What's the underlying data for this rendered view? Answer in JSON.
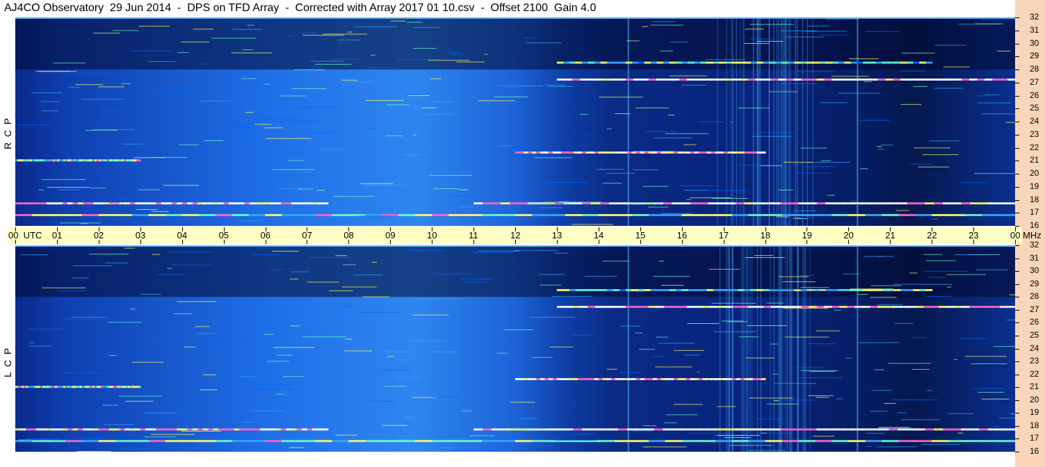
{
  "title": "AJ4CO Observatory  29 Jun 2014  -  DPS on TFD Array  -  Corrected with Array 2017 01 10.csv  -  Offset 2100  Gain 4.0",
  "panels": [
    {
      "id": "rcp",
      "label": "R  C  P"
    },
    {
      "id": "lcp",
      "label": "L  C  P"
    }
  ],
  "chart_data": {
    "type": "heatmap",
    "title": "AJ4CO Observatory  29 Jun 2014  -  DPS on TFD Array  -  Corrected with Array 2017 01 10.csv  -  Offset 2100  Gain 4.0",
    "x_label_start": "00  UTC",
    "x_ticks": [
      "00",
      "01",
      "02",
      "03",
      "04",
      "05",
      "06",
      "07",
      "08",
      "09",
      "10",
      "11",
      "12",
      "13",
      "14",
      "15",
      "16",
      "17",
      "18",
      "19",
      "20",
      "21",
      "22",
      "23",
      "00"
    ],
    "x_unit": "MHz",
    "y_unit": "MHz",
    "y_ticks": [
      16,
      17,
      18,
      19,
      20,
      21,
      22,
      23,
      24,
      25,
      26,
      27,
      28,
      29,
      30,
      31,
      32
    ],
    "ylim": [
      16,
      32
    ],
    "xlim_hours": [
      0,
      24
    ],
    "series": [
      {
        "name": "R C P"
      },
      {
        "name": "L C P"
      }
    ],
    "colormap": [
      "#000033",
      "#001a66",
      "#0033cc",
      "#0066ff",
      "#33aaff",
      "#66ffcc",
      "#ffff66",
      "#ff66cc",
      "#ffffff"
    ],
    "features": [
      {
        "freq_mhz": 27.2,
        "x_start_h": 13.0,
        "x_end_h": 24.0,
        "intensity": 0.85
      },
      {
        "freq_mhz": 21.6,
        "x_start_h": 12.0,
        "x_end_h": 18.0,
        "intensity": 0.8
      },
      {
        "freq_mhz": 17.7,
        "x_start_h": 0.0,
        "x_end_h": 7.5,
        "intensity": 0.8
      },
      {
        "freq_mhz": 17.7,
        "x_start_h": 11.0,
        "x_end_h": 24.0,
        "intensity": 0.85
      },
      {
        "freq_mhz": 16.8,
        "x_start_h": 0.0,
        "x_end_h": 24.0,
        "intensity": 0.6
      },
      {
        "freq_mhz": 21.0,
        "x_start_h": 0.0,
        "x_end_h": 3.0,
        "intensity": 0.6
      },
      {
        "freq_mhz": 28.5,
        "x_start_h": 13.0,
        "x_end_h": 22.0,
        "intensity": 0.55
      }
    ]
  }
}
